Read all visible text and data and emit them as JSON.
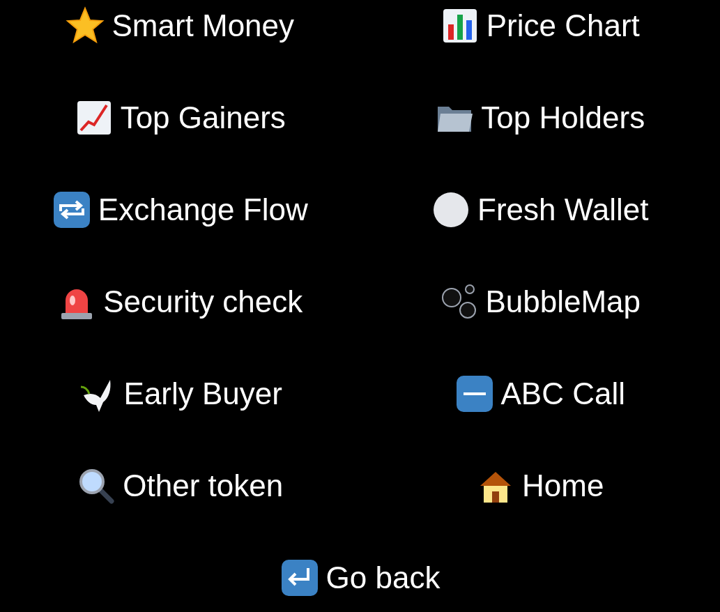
{
  "buttons": [
    {
      "label": "Smart Money"
    },
    {
      "label": "Price Chart"
    },
    {
      "label": "Top Gainers"
    },
    {
      "label": "Top Holders"
    },
    {
      "label": "Exchange Flow"
    },
    {
      "label": "Fresh Wallet"
    },
    {
      "label": "Security check"
    },
    {
      "label": "BubbleMap"
    },
    {
      "label": "Early Buyer"
    },
    {
      "label": "ABC Call"
    },
    {
      "label": "Other token"
    },
    {
      "label": "Home"
    }
  ],
  "back_button": {
    "label": "Go back"
  }
}
